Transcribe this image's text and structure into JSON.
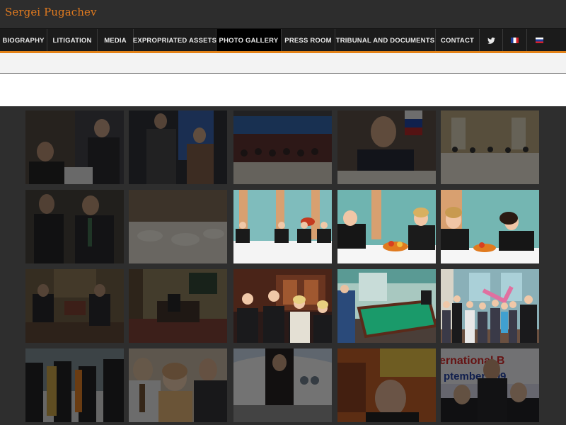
{
  "header": {
    "site_title": "Sergei Pugachev"
  },
  "nav": {
    "items": [
      {
        "label": "BIOGRAPHY"
      },
      {
        "label": "LITIGATION"
      },
      {
        "label": "MEDIA"
      },
      {
        "label": "EXPROPRIATED ASSETS"
      },
      {
        "label": "PHOTO GALLERY",
        "active": true
      },
      {
        "label": "PRESS ROOM"
      },
      {
        "label": "TRIBUNAL AND DOCUMENTS"
      },
      {
        "label": "CONTACT"
      }
    ],
    "twitter_icon": "twitter-icon",
    "flags": [
      "flag-fr-icon",
      "flag-ru-icon"
    ]
  },
  "colors": {
    "accent": "#e38218",
    "nav_bg": "#1b1b1b",
    "active_bg": "#000000"
  },
  "gallery": {
    "thumbnail_text": {
      "banner_fragment": "ernational B",
      "date_fragment": "ptember 199"
    }
  }
}
